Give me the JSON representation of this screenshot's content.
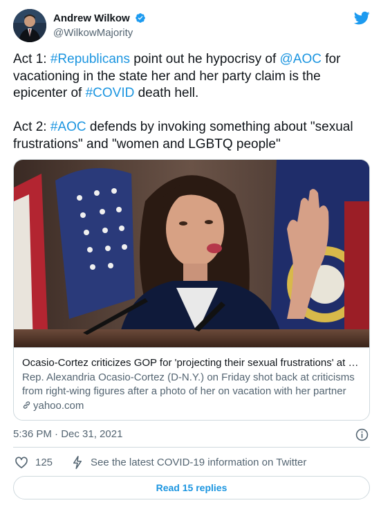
{
  "user": {
    "name": "Andrew Wilkow",
    "handle": "@WilkowMajority"
  },
  "tweet": {
    "paragraph1": [
      {
        "text": "Act 1: ",
        "tag": false
      },
      {
        "text": "#Republicans",
        "tag": true
      },
      {
        "text": " point out he hypocrisy of ",
        "tag": false
      },
      {
        "text": "@AOC",
        "tag": true
      },
      {
        "text": " for vacationing in the state her and her party claim is the epicenter of ",
        "tag": false
      },
      {
        "text": "#COVID",
        "tag": true
      },
      {
        "text": " death hell.",
        "tag": false
      }
    ],
    "paragraph2": [
      {
        "text": "Act 2: ",
        "tag": false
      },
      {
        "text": "#AOC",
        "tag": true
      },
      {
        "text": " defends by invoking something about \"sexual frustrations\"  and \"women and LGBTQ  people\"",
        "tag": false
      }
    ]
  },
  "card": {
    "title": "Ocasio-Cortez criticizes GOP for 'projecting their sexual frustrations' at her",
    "description_line1": "Rep. Alexandria Ocasio-Cortez (D-N.Y.) on Friday shot back at criticisms",
    "description_line2": "from right-wing figures after a photo of her on vacation with her partner",
    "domain": "yahoo.com"
  },
  "meta": {
    "timestamp": "5:36 PM · Dec 31, 2021"
  },
  "actions": {
    "like_count": "125",
    "covid_link": "See the latest COVID-19 information on Twitter",
    "replies_label": "Read 15 replies"
  },
  "colors": {
    "link": "#1b95e0",
    "secondary_text": "#536471",
    "border": "#cfd9de"
  }
}
